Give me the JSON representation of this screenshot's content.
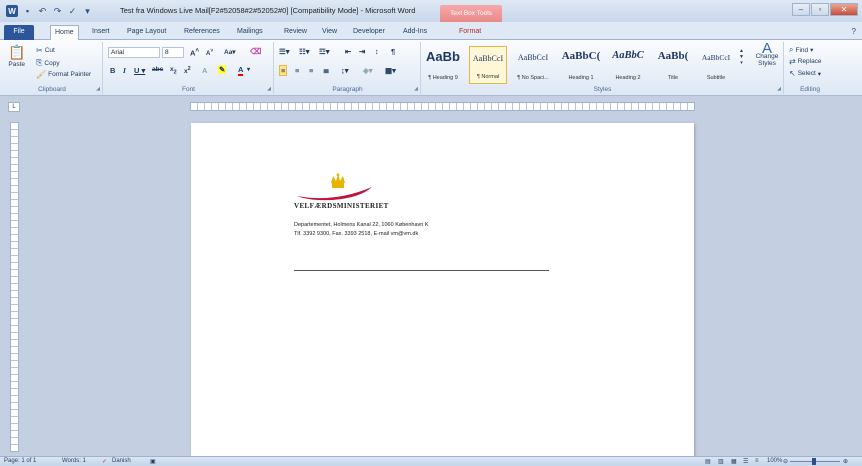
{
  "window": {
    "title": "Test fra Windows Live Mail[F2#52058#2#52052#0] [Compatibility Mode] - Microsoft Word",
    "contextual_tab_header": "Text Box Tools"
  },
  "tabs": [
    "File",
    "Home",
    "Insert",
    "Page Layout",
    "References",
    "Mailings",
    "Review",
    "View",
    "Developer",
    "Add-Ins",
    "Format"
  ],
  "ribbon": {
    "clipboard": {
      "paste": "Paste",
      "cut": "Cut",
      "copy": "Copy",
      "format_painter": "Format Painter",
      "label": "Clipboard"
    },
    "font": {
      "name": "Arial",
      "size": "8",
      "label": "Font"
    },
    "paragraph": {
      "label": "Paragraph"
    },
    "styles": {
      "label": "Styles",
      "items": [
        {
          "sample": "AaBb",
          "name": "¶ Heading 9"
        },
        {
          "sample": "AaBbCcI",
          "name": "¶ Normal"
        },
        {
          "sample": "AaBbCcI",
          "name": "¶ No Spaci..."
        },
        {
          "sample": "AaBbC(",
          "name": "Heading 1"
        },
        {
          "sample": "AaBbC",
          "name": "Heading 2"
        },
        {
          "sample": "AaBb(",
          "name": "Title"
        },
        {
          "sample": "AaBbCcI",
          "name": "Subtitle"
        }
      ],
      "change_styles": "Change Styles"
    },
    "editing": {
      "find": "Find",
      "replace": "Replace",
      "select": "Select",
      "label": "Editing"
    }
  },
  "document": {
    "ministry": "VELFÆRDSMINISTERIET",
    "address_line1": "Departementet, Holmens Kanal 22, 1060 København K",
    "address_line2": "Tlf. 3392 9300, Fax. 3393 2518, E-mail vm@vm.dk"
  },
  "status": {
    "page": "Page: 1 of 1",
    "words": "Words: 1",
    "language": "Danish",
    "zoom": "100%"
  },
  "colors": {
    "word_blue": "#2b579a",
    "ribbon_bg": "#dde7f4",
    "crown_gold": "#e8b400",
    "swoosh": "#c0143c"
  }
}
